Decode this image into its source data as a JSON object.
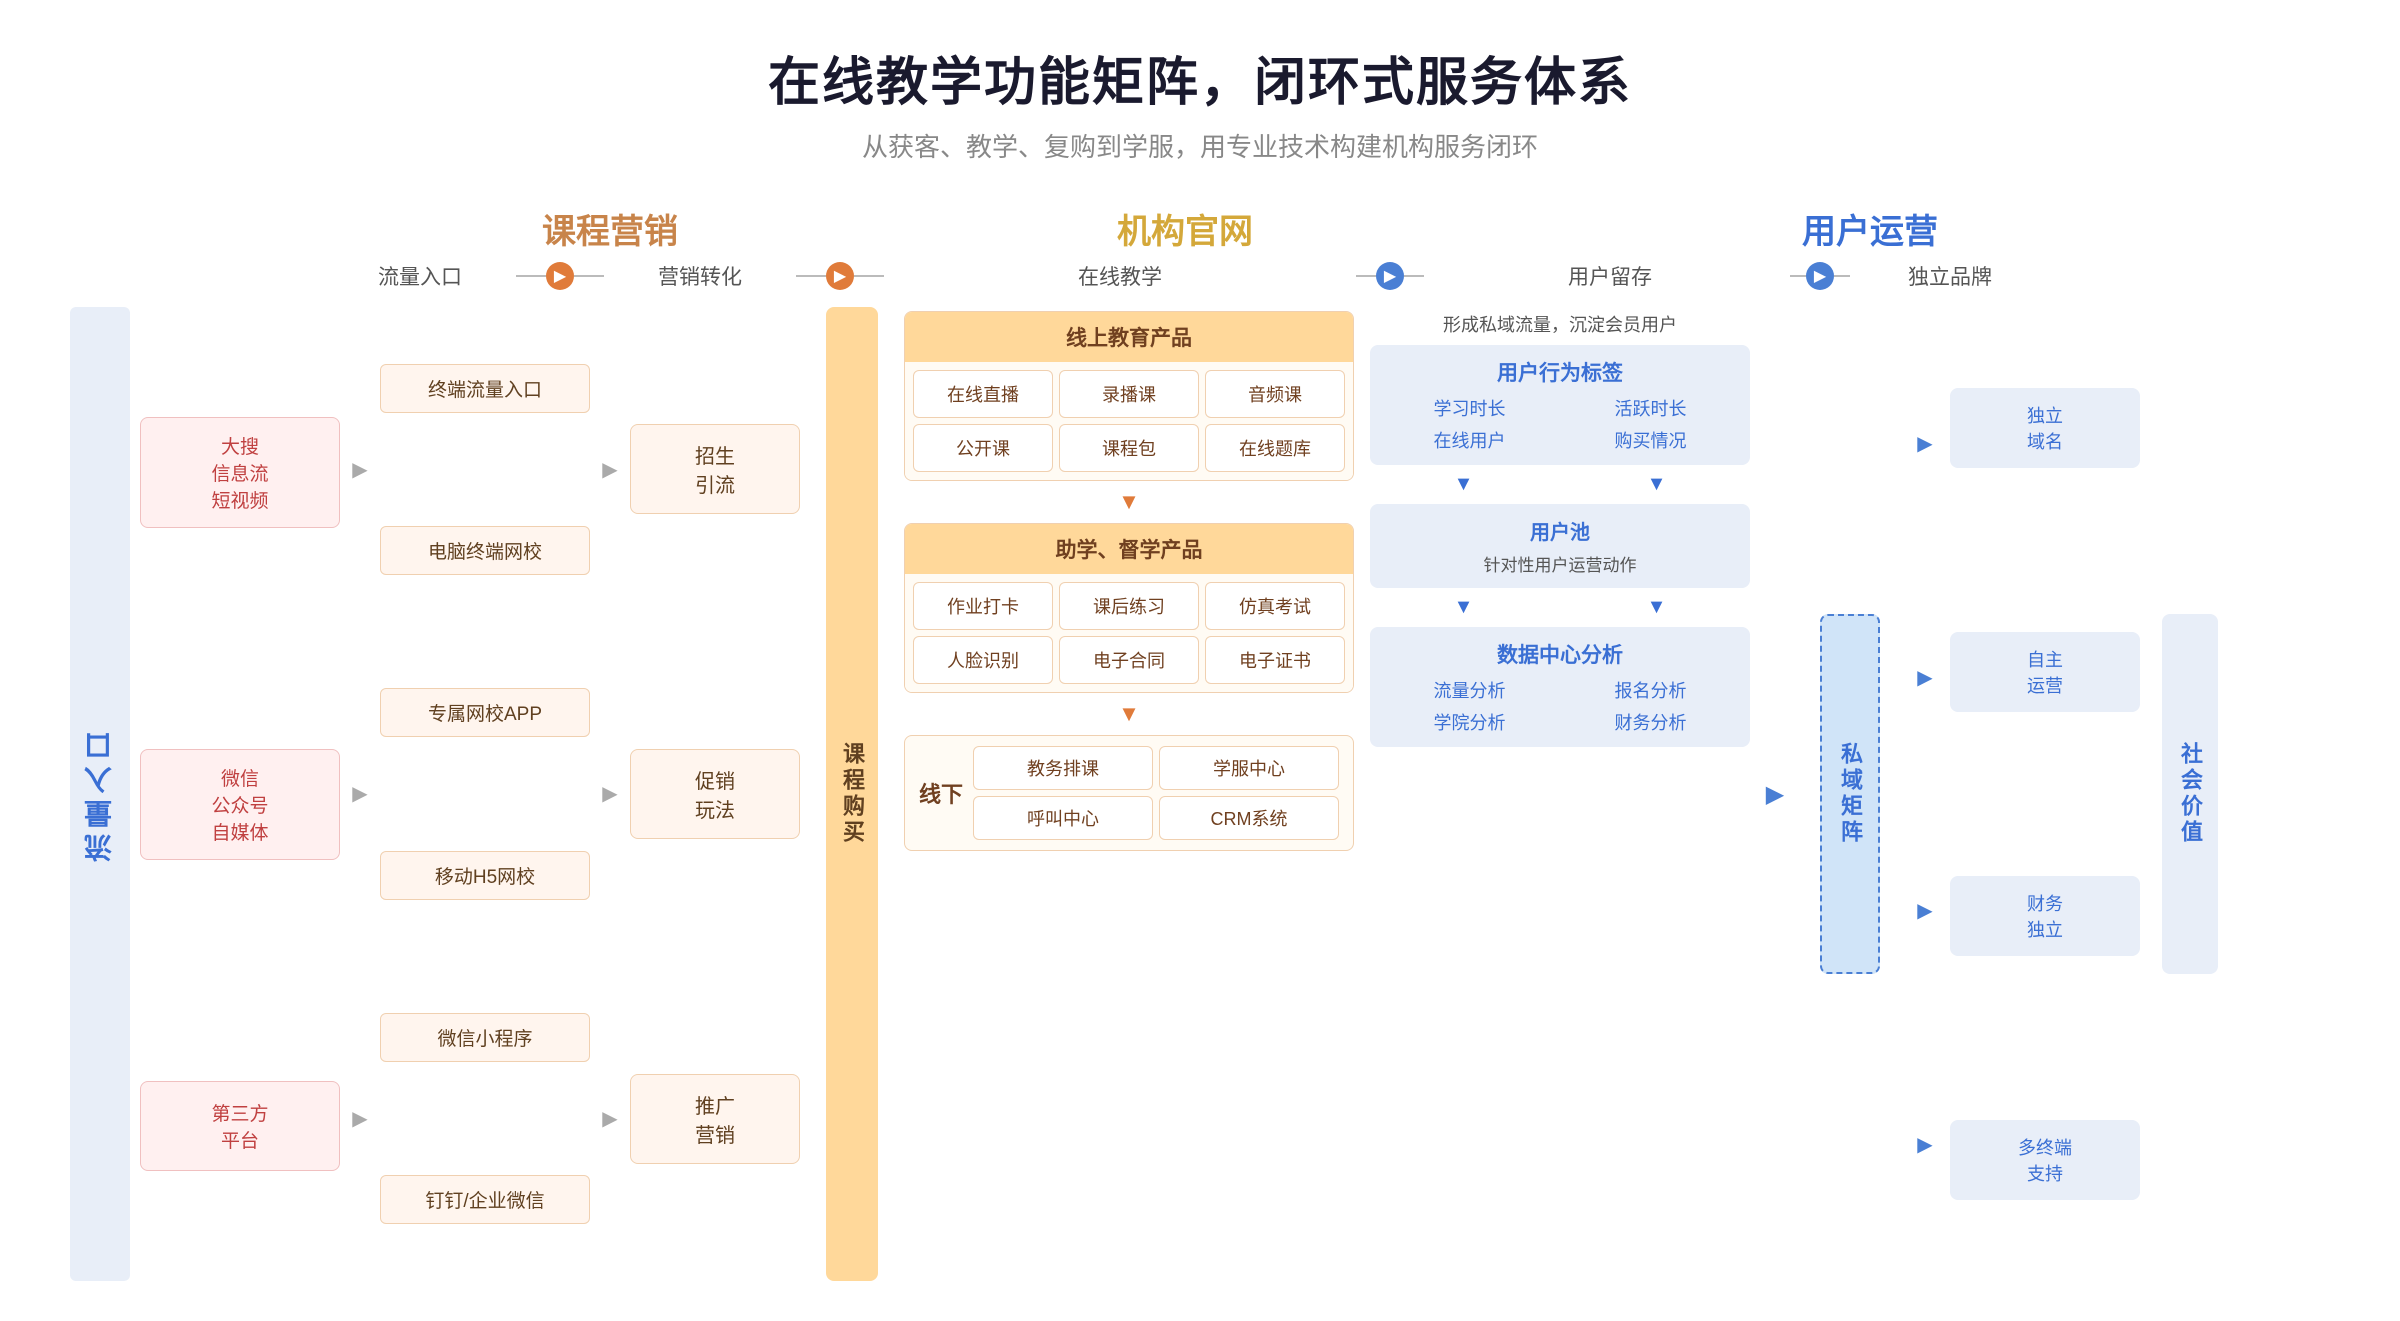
{
  "page": {
    "title": "在线教学功能矩阵，闭环式服务体系",
    "subtitle": "从获客、教学、复购到学服，用专业技术构建机构服务闭环"
  },
  "sections": {
    "marketing_label": "课程营销",
    "official_label": "机构官网",
    "operations_label": "用户运营"
  },
  "flow_labels": {
    "traffic_entry": "流量入口",
    "marketing_conversion": "营销转化",
    "online_teaching": "在线教学",
    "user_retention": "用户留存",
    "independent_brand": "独立品牌"
  },
  "left_label": "流量入口",
  "traffic_sources": [
    "大搜\n信息流\n短视频",
    "微信\n公众号\n自媒体",
    "第三方\n平台"
  ],
  "marketing_items": [
    "终端流量入口",
    "电脑终端网校",
    "专属网校APP",
    "移动H5网校",
    "微信小程序",
    "钉钉/企业微信"
  ],
  "conversion_items": [
    "招生\n引流",
    "促销\n玩法",
    "推广\n营销"
  ],
  "course_buy_label": "课程购买",
  "online_products": {
    "header": "线上教育产品",
    "items": [
      "在线直播",
      "录播课",
      "音频课",
      "公开课",
      "课程包",
      "在线题库"
    ]
  },
  "assist_products": {
    "header": "助学、督学产品",
    "items": [
      "作业打卡",
      "课后练习",
      "仿真考试",
      "人脸识别",
      "电子合同",
      "电子证书"
    ]
  },
  "offline": {
    "label": "线下",
    "items": [
      "教务排课",
      "学服中心",
      "呼叫中心",
      "CRM系统"
    ]
  },
  "user_retention": {
    "top_text": "形成私域流量，沉淀会员用户",
    "behavior_tags": {
      "header": "用户行为标签",
      "items": [
        "学习时长",
        "活跃时长",
        "在线用户",
        "购买情况"
      ]
    },
    "user_pool": {
      "header": "用户池",
      "action": "针对性用户运营动作"
    },
    "data_center": {
      "header": "数据中心分析",
      "items": [
        "流量分析",
        "报名分析",
        "学院分析",
        "财务分析"
      ]
    }
  },
  "private_domain_label": "私域矩阵",
  "independent_items": [
    "独立\n域名",
    "自主\n运营",
    "财务\n独立",
    "多终端\n支持"
  ],
  "social_value_label": "社会价值"
}
